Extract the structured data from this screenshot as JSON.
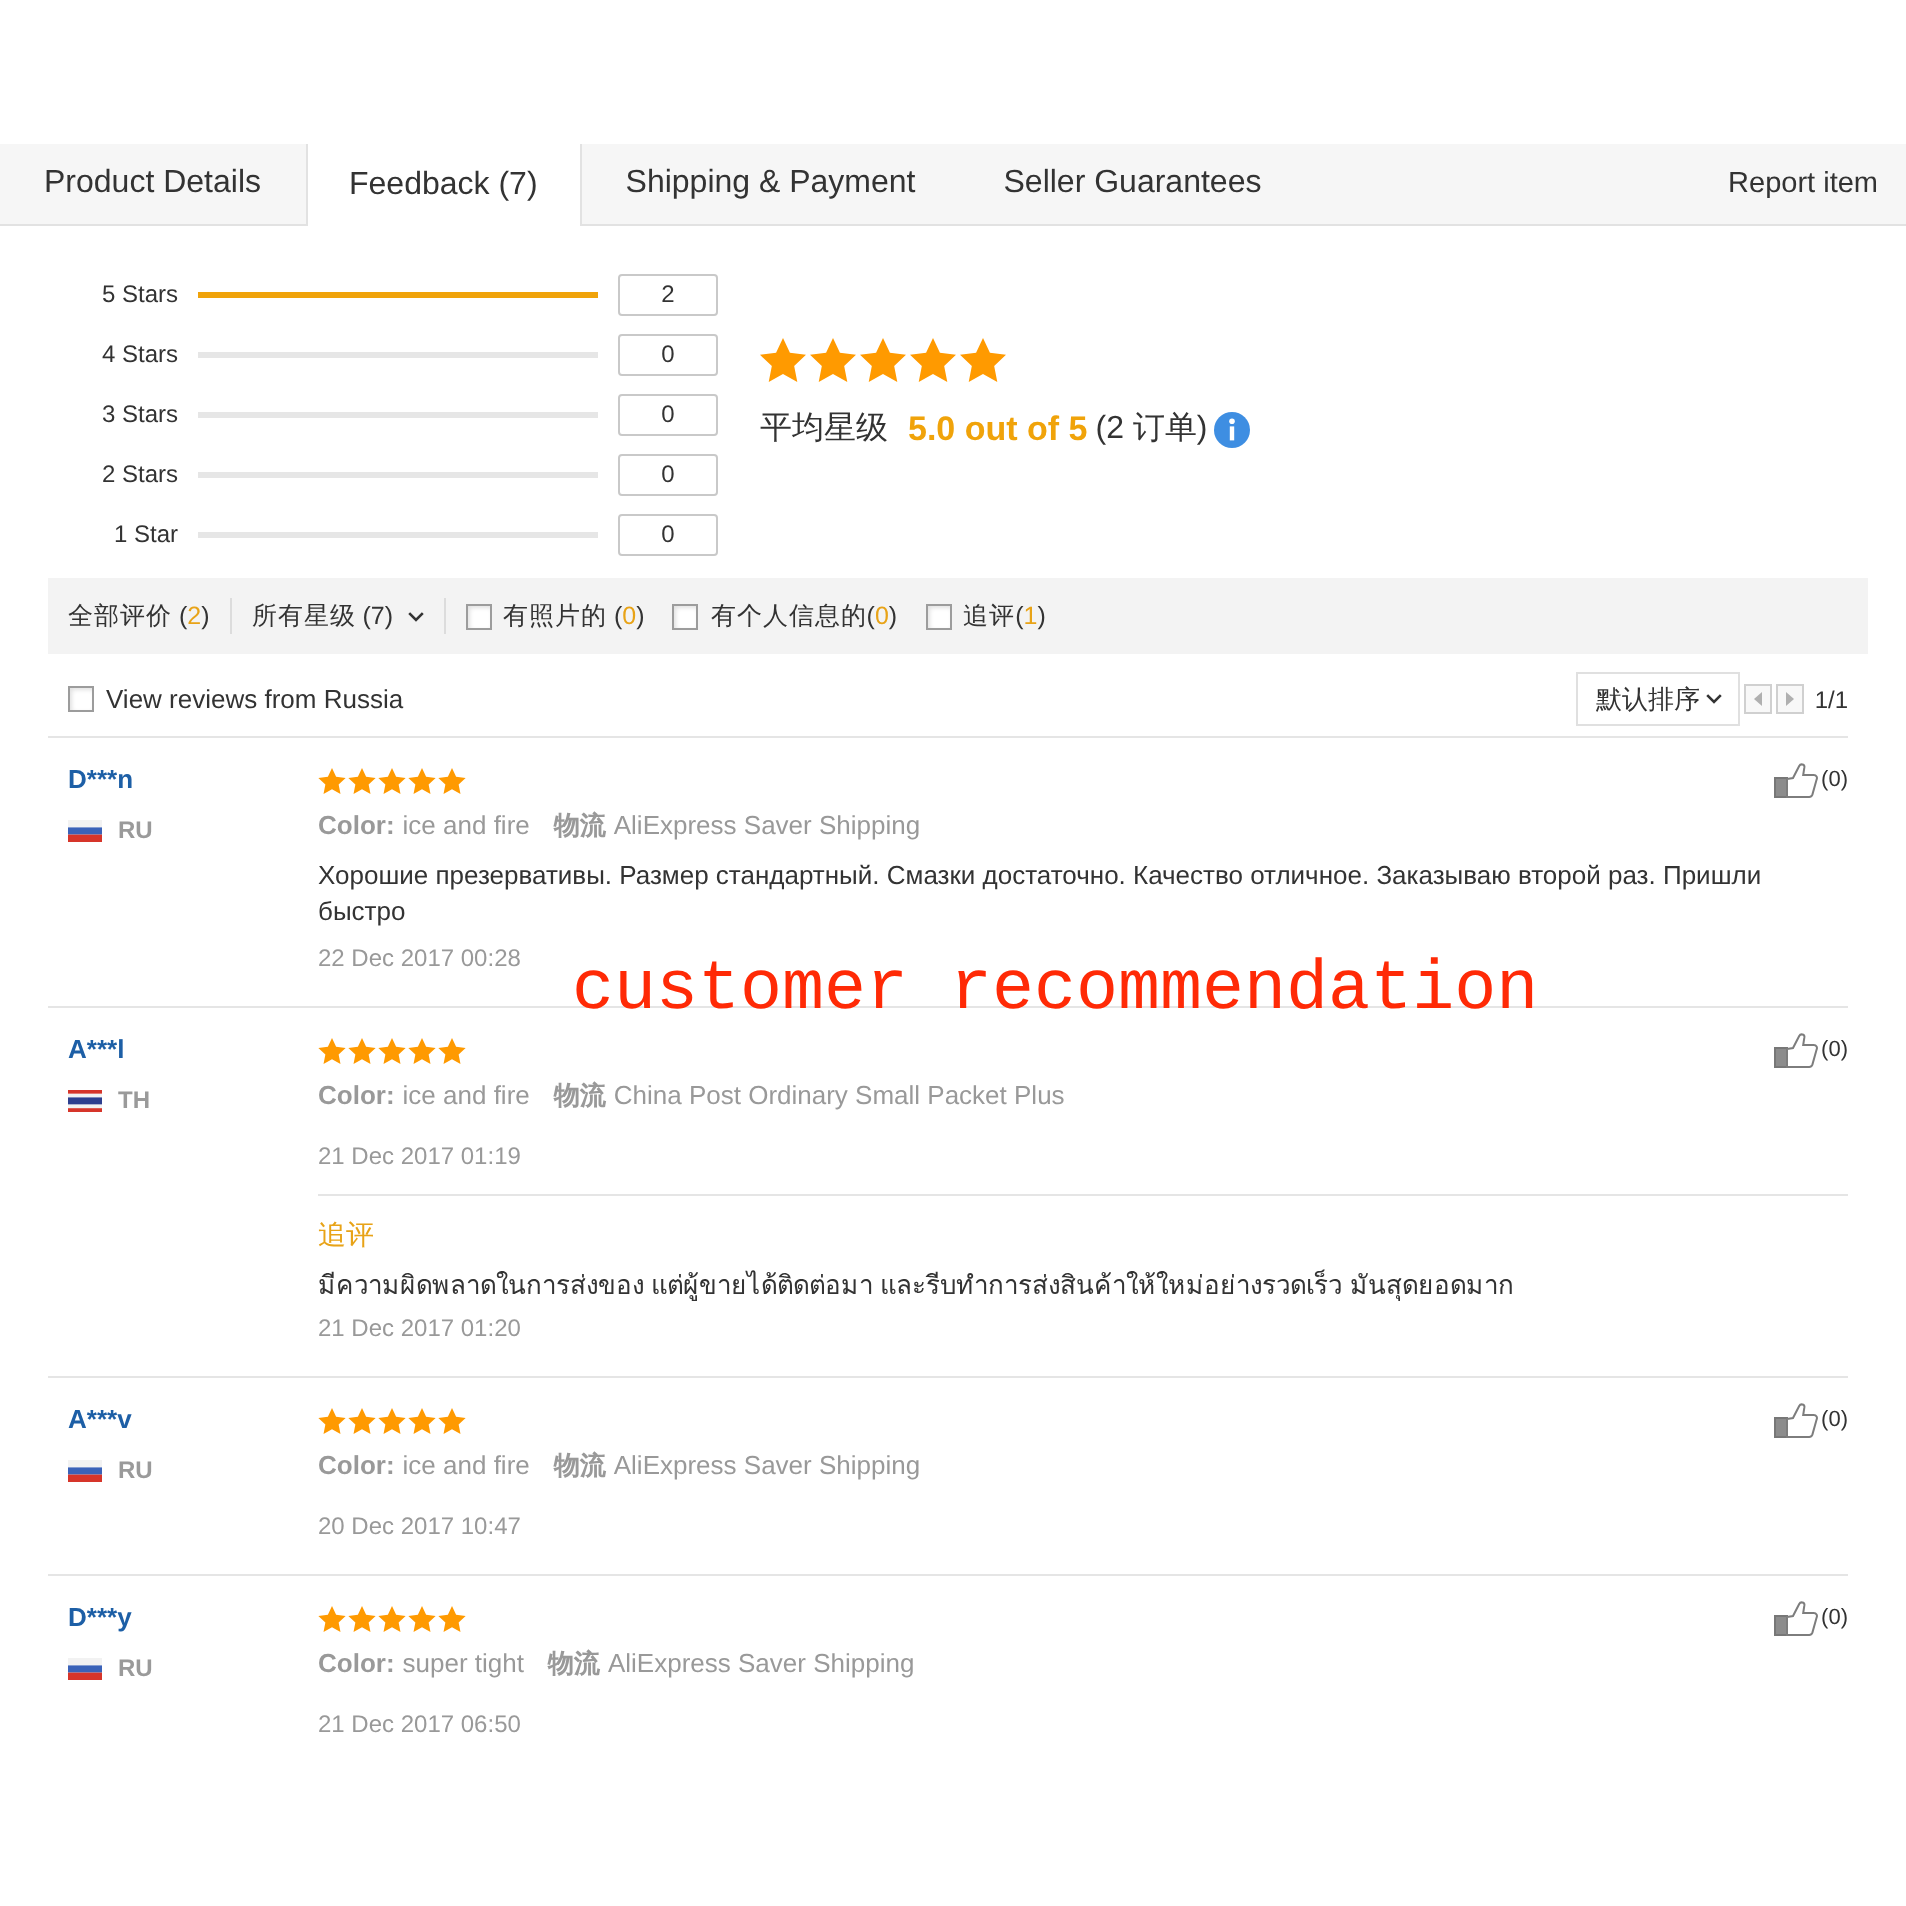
{
  "tabs": [
    {
      "label": "Product Details",
      "selected": false
    },
    {
      "label": "Feedback (7)",
      "selected": true
    },
    {
      "label": "Shipping & Payment",
      "selected": false
    },
    {
      "label": "Seller Guarantees",
      "selected": false
    }
  ],
  "report_link": "Report item",
  "rating_breakdown": [
    {
      "label": "5 Stars",
      "level": 1,
      "count": "2"
    },
    {
      "label": "4 Stars",
      "level": 0,
      "count": "0"
    },
    {
      "label": "3 Stars",
      "level": 0,
      "count": "0"
    },
    {
      "label": "2 Stars",
      "level": 0,
      "count": "0"
    },
    {
      "label": "1 Star",
      "level": 0,
      "count": "0"
    }
  ],
  "summary": {
    "stars": 5,
    "label": "平均星级",
    "score": "5.0 out of 5",
    "orders": "(2 订单)"
  },
  "filters": [
    {
      "kind": "link",
      "label": "全部评价 (*2*)"
    },
    {
      "kind": "dropdown",
      "label": "所有星级 (7)"
    },
    {
      "kind": "checkbox",
      "label": "有照片的 (*0*)",
      "checked": false
    },
    {
      "kind": "checkbox",
      "label": "有个人信息的(*0*)",
      "checked": false
    },
    {
      "kind": "checkbox",
      "label": "追评(*1*)",
      "checked": false
    }
  ],
  "region_filter": {
    "label": "View reviews from Russia",
    "checked": false
  },
  "sort": {
    "label": "默认排序"
  },
  "pager": {
    "text": "1/1"
  },
  "reviews": [
    {
      "name": "D***n",
      "flag": {
        "kind": "tricolor"
      },
      "country": "RU",
      "stars": 5,
      "variant_label": "Color:",
      "variant": "ice and fire",
      "shipping_label": "物流",
      "shipping": "AliExpress Saver Shipping",
      "text": "Хорошие презервативы. Размер стандартный. Смазки достаточно. Качество отличное. Заказываю второй раз. Пришли быстро",
      "date": "22 Dec 2017 00:28",
      "helpful": "(0)"
    },
    {
      "name": "A***l",
      "flag": {
        "kind": "fivestripe"
      },
      "country": "TH",
      "stars": 5,
      "variant_label": "Color:",
      "variant": "ice and fire",
      "shipping_label": "物流",
      "shipping": "China Post Ordinary Small Packet Plus",
      "date": "21 Dec 2017 01:19",
      "helpful": "(0)",
      "followup": {
        "label": "追评",
        "text": "มีความผิดพลาดในการส่งของ แต่ผู้ขายได้ติดต่อมา และรีบทำการส่งสินค้าให้ใหม่อย่างรวดเร็ว มันสุดยอดมาก",
        "date": "21 Dec 2017 01:20"
      }
    },
    {
      "name": "A***v",
      "flag": {
        "kind": "tricolor"
      },
      "country": "RU",
      "stars": 5,
      "variant_label": "Color:",
      "variant": "ice and fire",
      "shipping_label": "物流",
      "shipping": "AliExpress Saver Shipping",
      "date": "20 Dec 2017 10:47",
      "helpful": "(0)"
    },
    {
      "name": "D***y",
      "flag": {
        "kind": "tricolor"
      },
      "country": "RU",
      "stars": 5,
      "variant_label": "Color:",
      "variant": "super tight",
      "shipping_label": "物流",
      "shipping": "AliExpress Saver Shipping",
      "date": "21 Dec 2017 06:50",
      "helpful": "(0)"
    }
  ],
  "overlay_caption": "customer recommendation"
}
